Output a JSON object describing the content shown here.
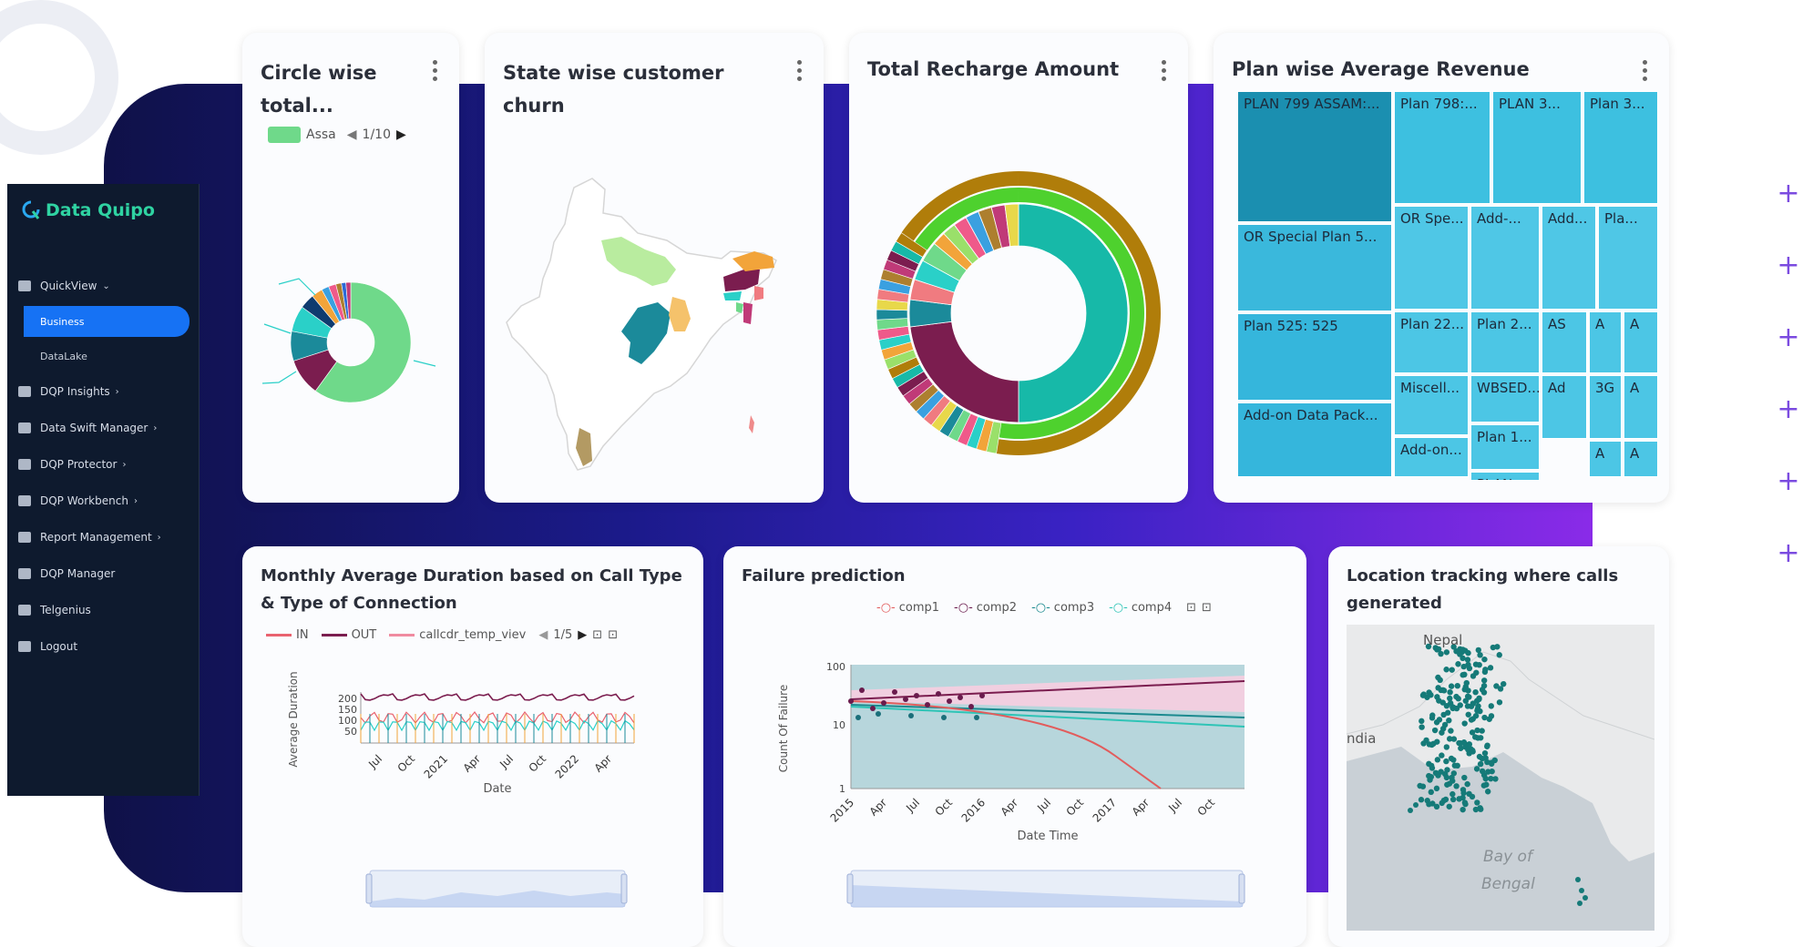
{
  "app": {
    "name": "Data Quipo"
  },
  "sidebar": {
    "items": [
      {
        "label": "QuickView",
        "icon": "dashboard-icon",
        "chevron": "⌄"
      },
      {
        "label": "Business",
        "sub": true,
        "active": true
      },
      {
        "label": "DataLake",
        "sub": true
      },
      {
        "label": "DQP Insights",
        "icon": "bar-chart-icon",
        "chevron": "›"
      },
      {
        "label": "Data Swift Manager",
        "icon": "gears-icon",
        "chevron": "›"
      },
      {
        "label": "DQP Protector",
        "icon": "shield-icon",
        "chevron": "›"
      },
      {
        "label": "DQP Workbench",
        "icon": "database-icon",
        "chevron": "›"
      },
      {
        "label": "Report Management",
        "icon": "report-icon",
        "chevron": "›"
      },
      {
        "label": "DQP Manager",
        "icon": "hierarchy-icon",
        "chevron": ""
      },
      {
        "label": "Telgenius",
        "icon": "code-icon",
        "chevron": ""
      },
      {
        "label": "Logout",
        "icon": "logout-icon",
        "chevron": ""
      }
    ]
  },
  "cards": {
    "circle": {
      "title_line1": "Circle wise",
      "title_line2": "total...",
      "legend_label": "Assa",
      "pager": "1/10",
      "legend_color": "#6fd98a"
    },
    "state": {
      "title_line1": "State wise customer",
      "title_line2": "churn"
    },
    "recharge": {
      "title": "Total Recharge Amount"
    },
    "plan": {
      "title": "Plan wise Average Revenue"
    },
    "monthly": {
      "title_line1": "Monthly Average Duration based on Call Type",
      "title_line2": "& Type of Connection",
      "legend": [
        {
          "name": "IN",
          "color": "#e9636f"
        },
        {
          "name": "OUT",
          "color": "#7b1d4f"
        },
        {
          "name": "callcdr_temp_viev",
          "color": "#f08ba0"
        }
      ],
      "pager": "1/5",
      "ylabel": "Average Duration",
      "xlabel": "Date",
      "yticks": [
        "200",
        "150",
        "100",
        "50"
      ],
      "xticks": [
        "Jul",
        "Oct",
        "2021",
        "Apr",
        "Jul",
        "Oct",
        "2022",
        "Apr"
      ]
    },
    "failure": {
      "title": "Failure prediction",
      "legend": [
        {
          "name": "comp1",
          "color": "#e25c5c"
        },
        {
          "name": "comp2",
          "color": "#6a1b4d"
        },
        {
          "name": "comp3",
          "color": "#1b8a8f"
        },
        {
          "name": "comp4",
          "color": "#2ec4b6"
        }
      ],
      "ylabel": "Count Of Failure",
      "xlabel": "Date Time",
      "yticks": [
        "100",
        "10",
        "1"
      ],
      "xticks": [
        "2015",
        "Apr",
        "Jul",
        "Oct",
        "2016",
        "Apr",
        "Jul",
        "Oct",
        "2017",
        "Apr",
        "Jul",
        "Oct"
      ]
    },
    "location": {
      "title_line1": "Location tracking where calls",
      "title_line2": "generated",
      "map_labels": [
        "Nepal",
        "ndia",
        "Bay of",
        "Bengal"
      ]
    }
  },
  "treemap": {
    "tiles": [
      {
        "label": "PLAN 799 ASSAM:...",
        "color": "#1b8fb0"
      },
      {
        "label": "Plan 798:...",
        "color": "#3dc0e0"
      },
      {
        "label": "PLAN 3...",
        "color": "#3dc0e0"
      },
      {
        "label": "Plan 3...",
        "color": "#3dc0e0"
      },
      {
        "label": "OR Special Plan 5...",
        "color": "#3ab8dc"
      },
      {
        "label": "OR Spe...",
        "color": "#4fc7e6"
      },
      {
        "label": "Add-...",
        "color": "#4fc7e6"
      },
      {
        "label": "Add...",
        "color": "#4fc7e6"
      },
      {
        "label": "Pla...",
        "color": "#4fc7e6"
      },
      {
        "label": "Plan 525: 525",
        "color": "#35b6dc"
      },
      {
        "label": "Plan 22...",
        "color": "#4cc6e5"
      },
      {
        "label": "Plan 2...",
        "color": "#4cc6e5"
      },
      {
        "label": "AS",
        "color": "#4cc6e5"
      },
      {
        "label": "A",
        "color": "#4cc6e5"
      },
      {
        "label": "A",
        "color": "#4cc6e5"
      },
      {
        "label": "WBSED...",
        "color": "#4cc6e5"
      },
      {
        "label": "Miscell...",
        "color": "#4cc6e5"
      },
      {
        "label": "Ad",
        "color": "#4cc6e5"
      },
      {
        "label": "3G",
        "color": "#4cc6e5"
      },
      {
        "label": "A",
        "color": "#4cc6e5"
      },
      {
        "label": "Add-on Data Pack...",
        "color": "#35b6dc"
      },
      {
        "label": "Plan 1...",
        "color": "#4cc6e5"
      },
      {
        "label": "Add-on...",
        "color": "#4cc6e5"
      },
      {
        "label": "A",
        "color": "#4cc6e5"
      },
      {
        "label": "A",
        "color": "#4cc6e5"
      },
      {
        "label": "PLAN ...",
        "color": "#4cc6e5"
      }
    ]
  },
  "charts": {
    "circle_donut": {
      "values": [
        60,
        10,
        8,
        7,
        4,
        3,
        2,
        2,
        1.5,
        1.2,
        1.3
      ],
      "colors": [
        "#6fd98a",
        "#7b1d4f",
        "#1b8a9a",
        "#2ad0c8",
        "#0f3b6f",
        "#f2a43a",
        "#3aa0e0",
        "#ef5a8a",
        "#ad7f2f",
        "#2b6ad8",
        "#c03a78"
      ]
    },
    "sunburst_outer": {
      "value": 100,
      "color": "#b07d0a"
    },
    "sunburst_mid": {
      "value": 100,
      "color": "#4ed12e"
    },
    "sunburst_inner": {
      "values": [
        50,
        23,
        4,
        3,
        3,
        3,
        2,
        2,
        2,
        2,
        2,
        2,
        2
      ],
      "colors": [
        "#17b9a8",
        "#7b1d4f",
        "#1b8a9a",
        "#f07b80",
        "#2ad0c8",
        "#6fd98a",
        "#f2a43a",
        "#9ae06a",
        "#ef5a8a",
        "#3aa0e0",
        "#ad7f2f",
        "#c03a78",
        "#e8d84a"
      ]
    }
  },
  "colors": {
    "accent": "#1672f4",
    "sidebar_bg": "#0e1a2e",
    "logo_green": "#2fd3a2"
  }
}
